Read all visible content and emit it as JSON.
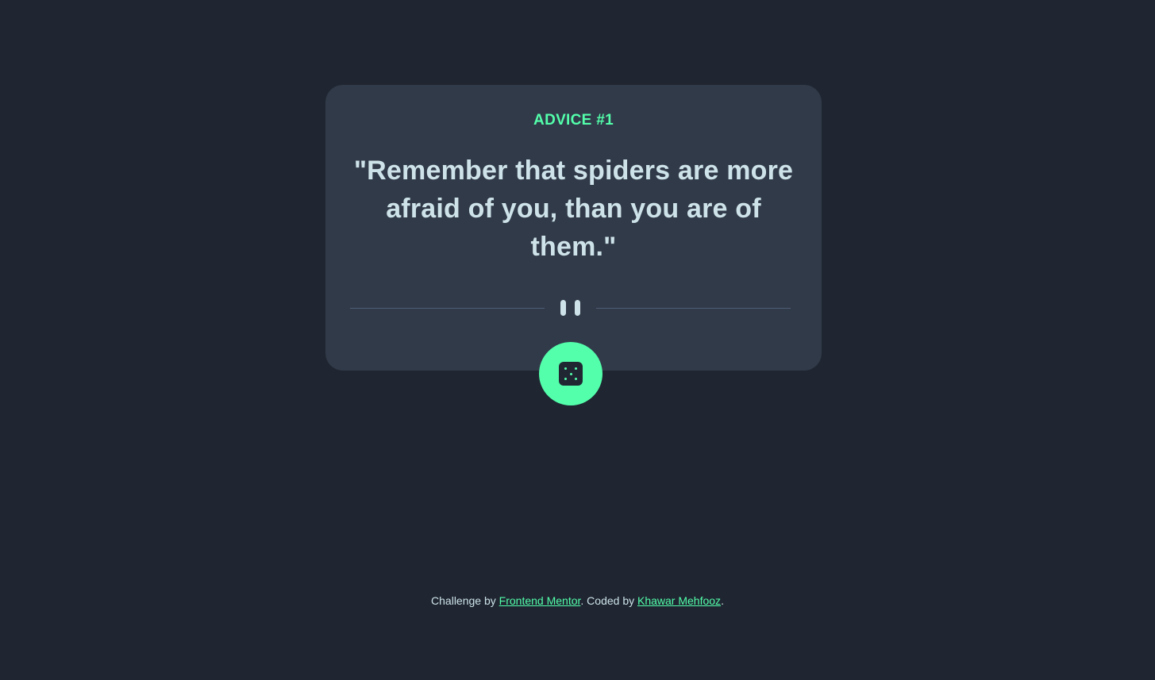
{
  "card": {
    "label": "ADVICE #1",
    "quote": "\"Remember that spiders are more afraid of you, than you are of them.\""
  },
  "footer": {
    "prefix": "Challenge by ",
    "challenge_link": "Frontend Mentor",
    "middle": ". Coded by ",
    "author_link": "Khawar Mehfooz",
    "suffix": "."
  },
  "colors": {
    "background": "#1f2631",
    "card": "#313a49",
    "accent": "#53ffab",
    "text": "#cee3e9",
    "divider": "#4f5d74"
  },
  "icons": {
    "divider": "pause-icon",
    "button": "dice-icon"
  }
}
